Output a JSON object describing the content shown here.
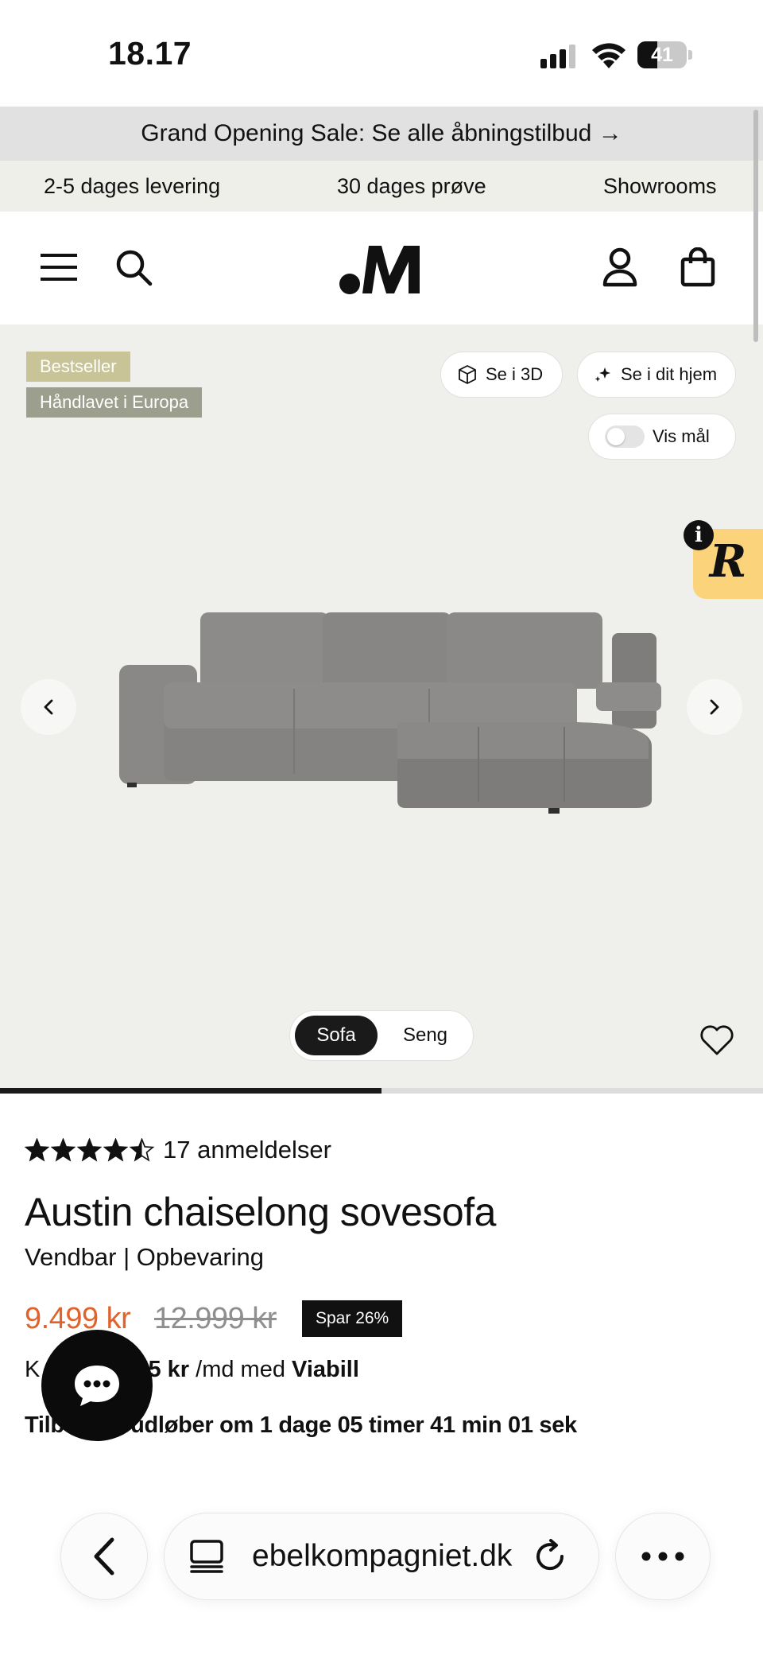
{
  "status_bar": {
    "time": "18.17",
    "battery": "41",
    "battery_level": 0.41
  },
  "promo_banner": {
    "text": "Grand Opening Sale: Se alle åbningstilbud →"
  },
  "usp": {
    "items": [
      "2-5 dages levering",
      "30 dages prøve",
      "Showrooms"
    ]
  },
  "header": {
    "logo_alt": "M",
    "icons": [
      "menu-icon",
      "search-icon",
      "account-icon",
      "shopping-bag-icon"
    ]
  },
  "gallery": {
    "badges": [
      "Bestseller",
      "Håndlavet i Europa"
    ],
    "view_3d_label": "Se i 3D",
    "view_home_label": "Se i dit hjem",
    "show_dimensions_label": "Vis mål",
    "show_dimensions_on": false,
    "variant_options": [
      "Sofa",
      "Seng"
    ],
    "selected_variant": "Sofa",
    "image_progress": 0.5
  },
  "product": {
    "rating": 4.5,
    "reviews_label": "17 anmeldelser",
    "title": "Austin chaiselong sovesofa",
    "subtitle": "Vendbar | Opbevaring",
    "price_now": "9.499 kr",
    "price_old": "12.999 kr",
    "save_badge": "Spar 26%",
    "finance_prefix": "K",
    "finance_amount": "75 kr",
    "finance_mid": "/md med",
    "finance_provider": "Viabill",
    "countdown": "Tilbud. et udløber om 1 dage 05 timer 41 min 01 sek"
  },
  "browser": {
    "url": "ebelkompagniet.dk"
  },
  "colors": {
    "accent_price": "#e1622a",
    "badge_bestseller": "#c8c497",
    "badge_handmade": "#9c9f8d",
    "gallery_bg": "#efefec",
    "banner_bg": "#e1e1e1"
  }
}
